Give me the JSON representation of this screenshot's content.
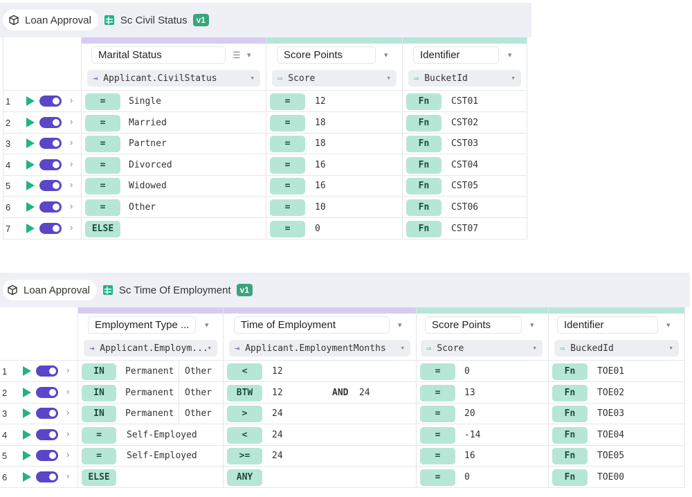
{
  "colors": {
    "accent": "#5b45c8",
    "play": "#1fb386",
    "op_bg": "#b6e6d6",
    "input_bar": "#d6ccf2",
    "output_bar": "#b5e6d7",
    "version_bg": "#3aa57b"
  },
  "table1": {
    "breadcrumb": {
      "project": "Loan Approval",
      "table": "Sc Civil Status",
      "version": "v1"
    },
    "columns": [
      {
        "name": "Marital Status",
        "path": "Applicant.CivilStatus"
      },
      {
        "name": "Score Points",
        "path": "Score"
      },
      {
        "name": "Identifier",
        "path": "BucketId"
      }
    ],
    "rows": [
      {
        "num": "1",
        "cond_op": "=",
        "cond_val": "Single",
        "score_op": "=",
        "score": "12",
        "id_op": "Fn",
        "id": "CST01"
      },
      {
        "num": "2",
        "cond_op": "=",
        "cond_val": "Married",
        "score_op": "=",
        "score": "18",
        "id_op": "Fn",
        "id": "CST02"
      },
      {
        "num": "3",
        "cond_op": "=",
        "cond_val": "Partner",
        "score_op": "=",
        "score": "18",
        "id_op": "Fn",
        "id": "CST03"
      },
      {
        "num": "4",
        "cond_op": "=",
        "cond_val": "Divorced",
        "score_op": "=",
        "score": "16",
        "id_op": "Fn",
        "id": "CST04"
      },
      {
        "num": "5",
        "cond_op": "=",
        "cond_val": "Widowed",
        "score_op": "=",
        "score": "16",
        "id_op": "Fn",
        "id": "CST05"
      },
      {
        "num": "6",
        "cond_op": "=",
        "cond_val": "Other",
        "score_op": "=",
        "score": "10",
        "id_op": "Fn",
        "id": "CST06"
      },
      {
        "num": "7",
        "cond_op": "ELSE",
        "cond_val": "",
        "score_op": "=",
        "score": "0",
        "id_op": "Fn",
        "id": "CST07"
      }
    ]
  },
  "table2": {
    "breadcrumb": {
      "project": "Loan Approval",
      "table": "Sc Time Of Employment",
      "version": "v1"
    },
    "columns": [
      {
        "name": "Employment Type ...",
        "path": "Applicant.Employm..."
      },
      {
        "name": "Time of Employment",
        "path": "Applicant.EmploymentMonths"
      },
      {
        "name": "Score Points",
        "path": "Score"
      },
      {
        "name": "Identifier",
        "path": "BuckedId"
      }
    ],
    "rows": [
      {
        "num": "1",
        "type_op": "IN",
        "type_vals": [
          "Permanent",
          "Other"
        ],
        "time_op": "<",
        "time_val": "12",
        "and": "",
        "time_val2": "",
        "score_op": "=",
        "score": "0",
        "id_op": "Fn",
        "id": "TOE01"
      },
      {
        "num": "2",
        "type_op": "IN",
        "type_vals": [
          "Permanent",
          "Other"
        ],
        "time_op": "BTW",
        "time_val": "12",
        "and": "AND",
        "time_val2": "24",
        "score_op": "=",
        "score": "13",
        "id_op": "Fn",
        "id": "TOE02"
      },
      {
        "num": "3",
        "type_op": "IN",
        "type_vals": [
          "Permanent",
          "Other"
        ],
        "time_op": ">",
        "time_val": "24",
        "and": "",
        "time_val2": "",
        "score_op": "=",
        "score": "20",
        "id_op": "Fn",
        "id": "TOE03"
      },
      {
        "num": "4",
        "type_op": "=",
        "type_vals": [
          "Self-Employed"
        ],
        "time_op": "<",
        "time_val": "24",
        "and": "",
        "time_val2": "",
        "score_op": "=",
        "score": "-14",
        "id_op": "Fn",
        "id": "TOE04"
      },
      {
        "num": "5",
        "type_op": "=",
        "type_vals": [
          "Self-Employed"
        ],
        "time_op": ">=",
        "time_val": "24",
        "and": "",
        "time_val2": "",
        "score_op": "=",
        "score": "16",
        "id_op": "Fn",
        "id": "TOE05"
      },
      {
        "num": "6",
        "type_op": "ELSE",
        "type_vals": [],
        "time_op": "ANY",
        "time_val": "",
        "and": "",
        "time_val2": "",
        "score_op": "=",
        "score": "0",
        "id_op": "Fn",
        "id": "TOE00"
      }
    ]
  }
}
